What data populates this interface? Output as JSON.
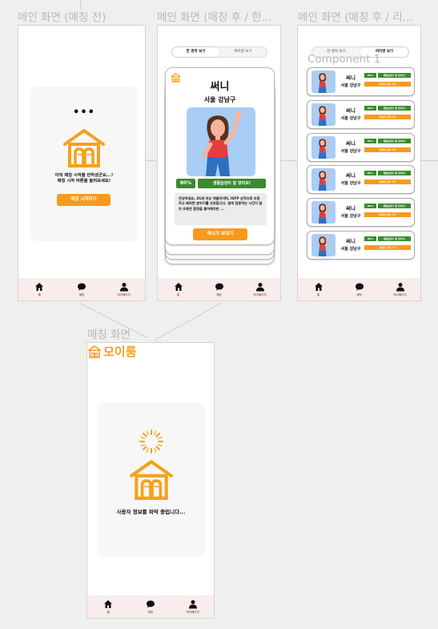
{
  "frame_labels": {
    "main_before": "메인 화면 (매칭 전)",
    "main_after_one": "메인 화면 (매칭 후 / 한...",
    "main_after_list": "메인 화면 (매칭 후 / 리...",
    "matching": "매칭 화면",
    "component": "Component 1"
  },
  "nav": {
    "home": "홈",
    "chat": "채팅",
    "mypage": "마이페이지"
  },
  "before": {
    "dots": "•••",
    "message_line1": "아직 매칭 시작을 안하셨군요...!",
    "message_line2": "매칭 시작 버튼을 눌러보세요!",
    "start_button": "매칭 시작하기"
  },
  "toggle": {
    "one": "한 명씩 보기",
    "list": "여러명 보기"
  },
  "profile": {
    "name": "써니",
    "location": "서울 강남구",
    "match_percent": "80%",
    "habit_text": "생활습관이 잘 맞아요!",
    "intro": "안녕하세요, 26세 여성 개발자이며, ISFP 성격으로 조용하고 배려한 분위기를 선호합니다. 밤에 집중하는 시간이 많아 조용한 환경을 좋아해지만 ...",
    "message_button": "메시지 보내기",
    "detail_button": "자세히 보러 가기"
  },
  "list_cards": [
    {
      "name": "써니",
      "location": "서울 강남구",
      "percent": "80%"
    },
    {
      "name": "써니",
      "location": "서울 강남구",
      "percent": "80%"
    },
    {
      "name": "써니",
      "location": "서울 강남구",
      "percent": "80%"
    },
    {
      "name": "써니",
      "location": "서울 강남구",
      "percent": "80%"
    },
    {
      "name": "써니",
      "location": "서울 강남구",
      "percent": "80%"
    },
    {
      "name": "써니",
      "location": "서울 강남구",
      "percent": "80%"
    }
  ],
  "matching": {
    "brand": "모이룸",
    "loading_text": "사용자 정보를 파악 중입니다..."
  },
  "colors": {
    "accent_orange": "#f79a1c",
    "habit_green": "#3a8a2e",
    "nav_bg": "#f8ecec",
    "avatar_bg": "#a9cdf5"
  }
}
